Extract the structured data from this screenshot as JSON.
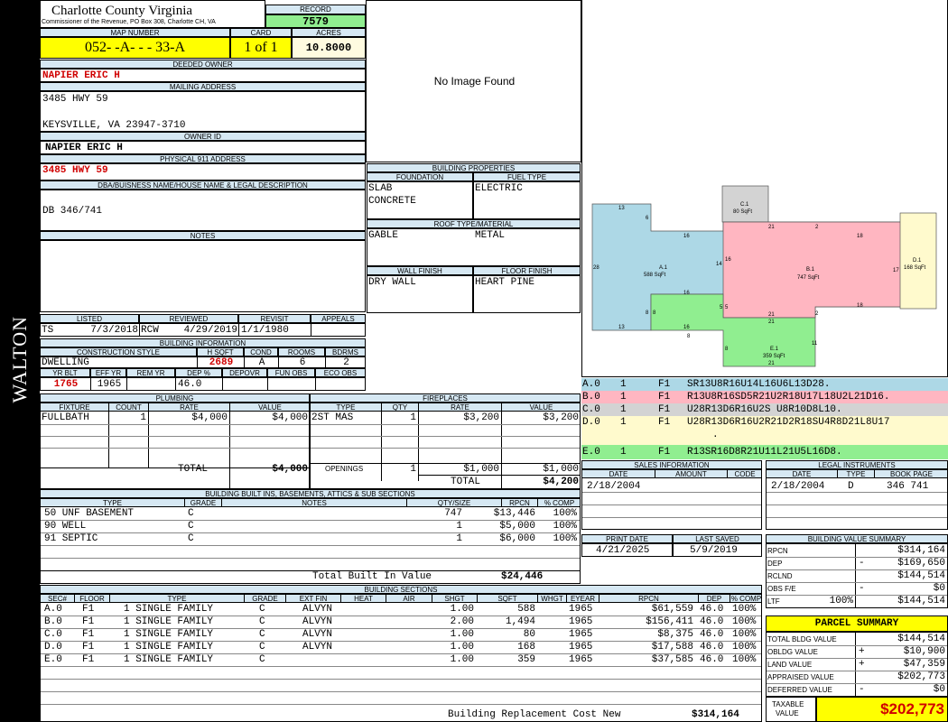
{
  "sidebar_label": "WALTON",
  "county": {
    "title": "Charlotte County Virginia",
    "subtitle": "Commissioner of the Revenue, PO Box 308, Charlotte CH, VA"
  },
  "record": {
    "label": "RECORD",
    "value": "7579"
  },
  "map_number": {
    "label": "MAP NUMBER",
    "value": "052- -A- - - 33-A"
  },
  "card": {
    "label": "CARD",
    "value": "1 of 1"
  },
  "acres": {
    "label": "ACRES",
    "value": "10.8000"
  },
  "deeded_owner": {
    "label": "DEEDED OWNER",
    "value": "NAPIER ERIC H"
  },
  "mailing_address": {
    "label": "MAILING ADDRESS",
    "line1": "3485 HWY 59",
    "line2": "KEYSVILLE, VA 23947-3710"
  },
  "owner_id": {
    "label": "OWNER ID",
    "value": "NAPIER ERIC H"
  },
  "physical_address": {
    "label": "PHYSICAL 911 ADDRESS",
    "value": "3485 HWY 59"
  },
  "legal_desc": {
    "label": "DBA/BUISNESS NAME/HOUSE NAME & LEGAL DESCRIPTION",
    "value": "DB 346/741"
  },
  "notes": {
    "label": "NOTES"
  },
  "image": {
    "text": "No Image Found"
  },
  "building_properties": {
    "label": "BUILDING PROPERTIES",
    "foundation_label": "FOUNDATION",
    "foundation1": "SLAB",
    "foundation2": "CONCRETE",
    "fuel_label": "FUEL TYPE",
    "fuel": "ELECTRIC",
    "roof_label": "ROOF TYPE/MATERIAL",
    "roof_type": "GABLE",
    "roof_material": "METAL",
    "wall_label": "WALL FINISH",
    "wall": "DRY WALL",
    "floor_label": "FLOOR FINISH",
    "floor": "HEART PINE"
  },
  "listing": {
    "listed_label": "LISTED",
    "listed_by": "TS",
    "listed_date": "7/3/2018",
    "reviewed_label": "REVIEWED",
    "reviewed_by": "RCW",
    "reviewed_date": "4/29/2019",
    "revisit_label": "REVISIT",
    "revisit": "1/1/1980",
    "appeals_label": "APPEALS"
  },
  "building_info": {
    "label": "BUILDING INFORMATION",
    "style_label": "CONSTRUCTION STYLE",
    "style": "DWELLING",
    "hsqft_label": "H SQFT",
    "hsqft": "2689",
    "cond_label": "COND",
    "cond": "A",
    "rooms_label": "ROOMS",
    "rooms": "6",
    "bdrms_label": "BDRMS",
    "bdrms": "2",
    "yrblt_label": "YR BLT",
    "yrblt": "1765",
    "effyr_label": "EFF YR",
    "effyr": "1965",
    "remyr_label": "REM YR",
    "dep_label": "DEP %",
    "dep": "46.0",
    "depovr_label": "DEPOVR",
    "funobs_label": "FUN OBS",
    "ecoobs_label": "ECO OBS"
  },
  "plumbing": {
    "label": "PLUMBING",
    "headers": [
      "FIXTURE",
      "COUNT",
      "RATE",
      "VALUE"
    ],
    "rows": [
      {
        "fixture": "FULLBATH",
        "count": "1",
        "rate": "$4,000",
        "value": "$4,000"
      }
    ],
    "total_label": "TOTAL",
    "total": "$4,000"
  },
  "fireplaces": {
    "label": "FIREPLACES",
    "headers": [
      "TYPE",
      "QTY",
      "RATE",
      "VALUE"
    ],
    "rows": [
      {
        "type": "2ST MAS",
        "qty": "1",
        "rate": "$3,200",
        "value": "$3,200"
      }
    ],
    "openings_label": "OPENINGS",
    "openings_qty": "1",
    "openings_rate": "$1,000",
    "openings_value": "$1,000",
    "total_label": "TOTAL",
    "total": "$4,200"
  },
  "builtins": {
    "label": "BUILDING BUILT INS, BASEMENTS, ATTICS & SUB SECTIONS",
    "headers": [
      "TYPE",
      "GRADE",
      "NOTES",
      "QTY/SIZE",
      "RPCN",
      "% COMP"
    ],
    "rows": [
      {
        "type": "50 UNF BASEMENT",
        "grade": "C",
        "qty": "747",
        "rpcn": "$13,446",
        "comp": "100%"
      },
      {
        "type": "90 WELL",
        "grade": "C",
        "qty": "1",
        "rpcn": "$5,000",
        "comp": "100%"
      },
      {
        "type": "91 SEPTIC",
        "grade": "C",
        "qty": "1",
        "rpcn": "$6,000",
        "comp": "100%"
      }
    ],
    "total_label": "Total Built In Value",
    "total": "$24,446"
  },
  "sketch": {
    "sections": [
      {
        "id": "A.1",
        "area": "588 SqFt",
        "color": "#add8e6"
      },
      {
        "id": "B.1",
        "area": "747 SqFt",
        "color": "#ffb6c1"
      },
      {
        "id": "C.1",
        "area": "80 SqFt",
        "color": "#d3d3d3"
      },
      {
        "id": "D.1",
        "area": "168 SqFt",
        "color": "#fffacd"
      },
      {
        "id": "E.1",
        "area": "359 SqFt",
        "color": "#90ee90"
      }
    ],
    "dims": [
      "13",
      "6",
      "16",
      "28",
      "13",
      "8",
      "8",
      "16",
      "16",
      "14",
      "16",
      "5",
      "5",
      "21",
      "2",
      "18",
      "17",
      "21",
      "2",
      "18",
      "8",
      "11",
      "21",
      "8",
      "21"
    ]
  },
  "sketch_codes": [
    {
      "sec": "A.0",
      "n": "1",
      "fl": "F1",
      "code": "SR13U8R16U14L16U6L13D28.",
      "color": "#add8e6"
    },
    {
      "sec": "B.0",
      "n": "1",
      "fl": "F1",
      "code": "R13U8R16SD5R21U2R18U17L18U2L21D16.",
      "color": "#ffb6c1"
    },
    {
      "sec": "C.0",
      "n": "1",
      "fl": "F1",
      "code": "U28R13D6R16U2S U8R10D8L10.",
      "color": "#d3d3d3"
    },
    {
      "sec": "D.0",
      "n": "1",
      "fl": "F1",
      "code": "U28R13D6R16U2R21D2R18SU4R8D21L8U17",
      "code2": ".",
      "color": "#fffacd"
    },
    {
      "sec": "E.0",
      "n": "1",
      "fl": "F1",
      "code": "R13SR16D8R21U11L21U5L16D8.",
      "color": "#90ee90"
    }
  ],
  "sales": {
    "label": "SALES INFORMATION",
    "headers": [
      "DATE",
      "AMOUNT",
      "CODE"
    ],
    "rows": [
      {
        "date": "2/18/2004",
        "amount": "",
        "code": ""
      }
    ]
  },
  "legal": {
    "label": "LEGAL INSTRUMENTS",
    "headers": [
      "DATE",
      "TYPE",
      "BOOK PAGE"
    ],
    "rows": [
      {
        "date": "2/18/2004",
        "type": "D",
        "bookpage": "346 741"
      }
    ]
  },
  "print": {
    "print_label": "PRINT DATE",
    "print_date": "4/21/2025",
    "saved_label": "LAST SAVED",
    "saved_date": "5/9/2019"
  },
  "value_summary": {
    "label": "BUILDING VALUE SUMMARY",
    "rows": [
      {
        "name": "RPCN",
        "sign": "",
        "pct": "",
        "value": "$314,164"
      },
      {
        "name": "DEP",
        "sign": "-",
        "pct": "",
        "value": "$169,650"
      },
      {
        "name": "RCLND",
        "sign": "",
        "pct": "",
        "value": "$144,514"
      },
      {
        "name": "OBS F/E",
        "sign": "-",
        "pct": "",
        "value": "$0"
      },
      {
        "name": "LTF",
        "sign": "",
        "pct": "100%",
        "value": "$144,514"
      }
    ]
  },
  "parcel_summary": {
    "label": "PARCEL SUMMARY",
    "rows": [
      {
        "name": "TOTAL BLDG VALUE",
        "sign": "",
        "value": "$144,514"
      },
      {
        "name": "OBLDG VALUE",
        "sign": "+",
        "value": "$10,900"
      },
      {
        "name": "LAND VALUE",
        "sign": "+",
        "value": "$47,359"
      },
      {
        "name": "APPRAISED VALUE",
        "sign": "",
        "value": "$202,773"
      },
      {
        "name": "DEFERRED VALUE",
        "sign": "-",
        "value": "$0"
      }
    ],
    "taxable_label1": "TAXABLE",
    "taxable_label2": "VALUE",
    "taxable": "$202,773"
  },
  "sections": {
    "label": "BUILDING SECTIONS",
    "headers": [
      "SEC#",
      "FLOOR",
      "TYPE",
      "GRADE",
      "EXT FIN",
      "HEAT",
      "AIR",
      "SHGT",
      "SQFT",
      "WHGT",
      "EYEAR",
      "RPCN",
      "DEP",
      "% COMP"
    ],
    "rows": [
      {
        "sec": "A.0",
        "floor": "F1",
        "type": "1 SINGLE FAMILY",
        "grade": "C",
        "ext": "ALVYN",
        "shgt": "1.00",
        "sqft": "588",
        "eyear": "1965",
        "rpcn": "$61,559",
        "dep": "46.0",
        "comp": "100%"
      },
      {
        "sec": "B.0",
        "floor": "F1",
        "type": "1 SINGLE FAMILY",
        "grade": "C",
        "ext": "ALVYN",
        "shgt": "2.00",
        "sqft": "1,494",
        "eyear": "1965",
        "rpcn": "$156,411",
        "dep": "46.0",
        "comp": "100%"
      },
      {
        "sec": "C.0",
        "floor": "F1",
        "type": "1 SINGLE FAMILY",
        "grade": "C",
        "ext": "ALVYN",
        "shgt": "1.00",
        "sqft": "80",
        "eyear": "1965",
        "rpcn": "$8,375",
        "dep": "46.0",
        "comp": "100%"
      },
      {
        "sec": "D.0",
        "floor": "F1",
        "type": "1 SINGLE FAMILY",
        "grade": "C",
        "ext": "ALVYN",
        "shgt": "1.00",
        "sqft": "168",
        "eyear": "1965",
        "rpcn": "$17,588",
        "dep": "46.0",
        "comp": "100%"
      },
      {
        "sec": "E.0",
        "floor": "F1",
        "type": "1 SINGLE FAMILY",
        "grade": "C",
        "ext": "",
        "shgt": "1.00",
        "sqft": "359",
        "eyear": "1965",
        "rpcn": "$37,585",
        "dep": "46.0",
        "comp": "100%"
      }
    ],
    "total_label": "Building Replacement Cost New",
    "total": "$314,164"
  }
}
